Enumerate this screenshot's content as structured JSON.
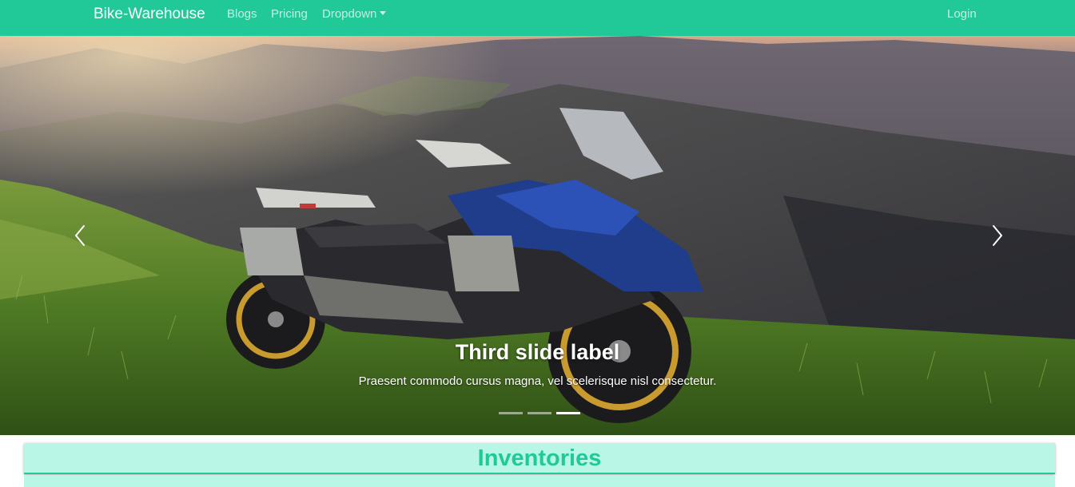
{
  "navbar": {
    "brand": "Bike-Warehouse",
    "links": [
      "Blogs",
      "Pricing",
      "Dropdown"
    ],
    "login": "Login",
    "color": "#20c997"
  },
  "carousel": {
    "active_slide": 3,
    "slide_count": 3,
    "caption_title": "Third slide label",
    "caption_text": "Praesent commodo cursus magna, vel scelerisque nisl consectetur.",
    "prev_icon": "chevron-left-icon",
    "next_icon": "chevron-right-icon"
  },
  "inventories": {
    "title": "Inventories",
    "background": "#b9f6e6",
    "accent": "#20c997"
  }
}
